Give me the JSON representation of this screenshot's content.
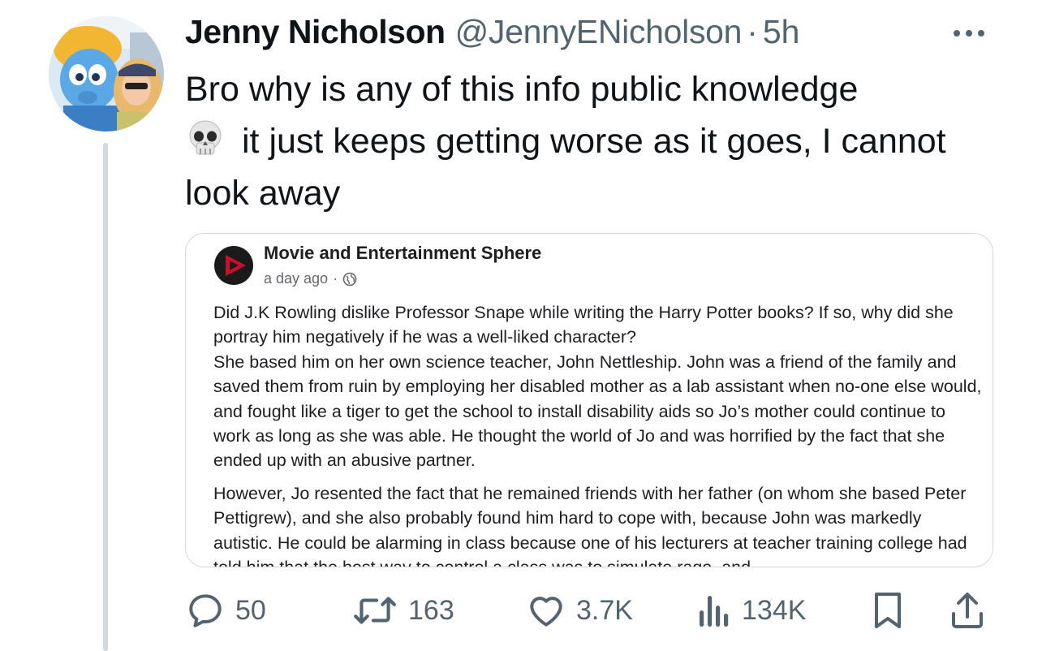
{
  "tweet": {
    "author_name": "Jenny Nicholson",
    "handle": "@JennyENicholson",
    "separator": "·",
    "time": "5h",
    "text_part1": "Bro why is any of this info public knowledge",
    "emoji_icon": "skull-emoji",
    "text_part2": "it just keeps getting worse as it goes, I cannot look away"
  },
  "quoted_post": {
    "page_name": "Movie and Entertainment Sphere",
    "time": "a day ago",
    "meta_separator": "·",
    "paragraph1": "Did J.K Rowling dislike Professor Snape while writing the Harry Potter books? If so, why did she portray him negatively if he was a well-liked character?",
    "paragraph2": "She based him on her own science teacher, John Nettleship. John was a friend of the family and saved them from ruin by employing her disabled mother as a lab assistant when no-one else would, and fought like a tiger to get the school to install disability aids so Jo’s mother could continue to work as long as she was able. He thought the world of Jo and was horrified by the fact that she ended up with an abusive partner.",
    "paragraph3": "However, Jo resented the fact that he remained friends with her father (on whom she based Peter Pettigrew), and she also probably found him hard to cope with, because John was markedly autistic. He could be alarming in class because one of his lecturers at teacher training college had told him that the best way to control a class was to simulate rage, and"
  },
  "actions": {
    "replies": "50",
    "reposts": "163",
    "likes": "3.7K",
    "views": "134K"
  },
  "colors": {
    "text": "#0f1419",
    "secondary": "#536471",
    "border": "#cfd9de",
    "brand_red": "#c8102e"
  }
}
